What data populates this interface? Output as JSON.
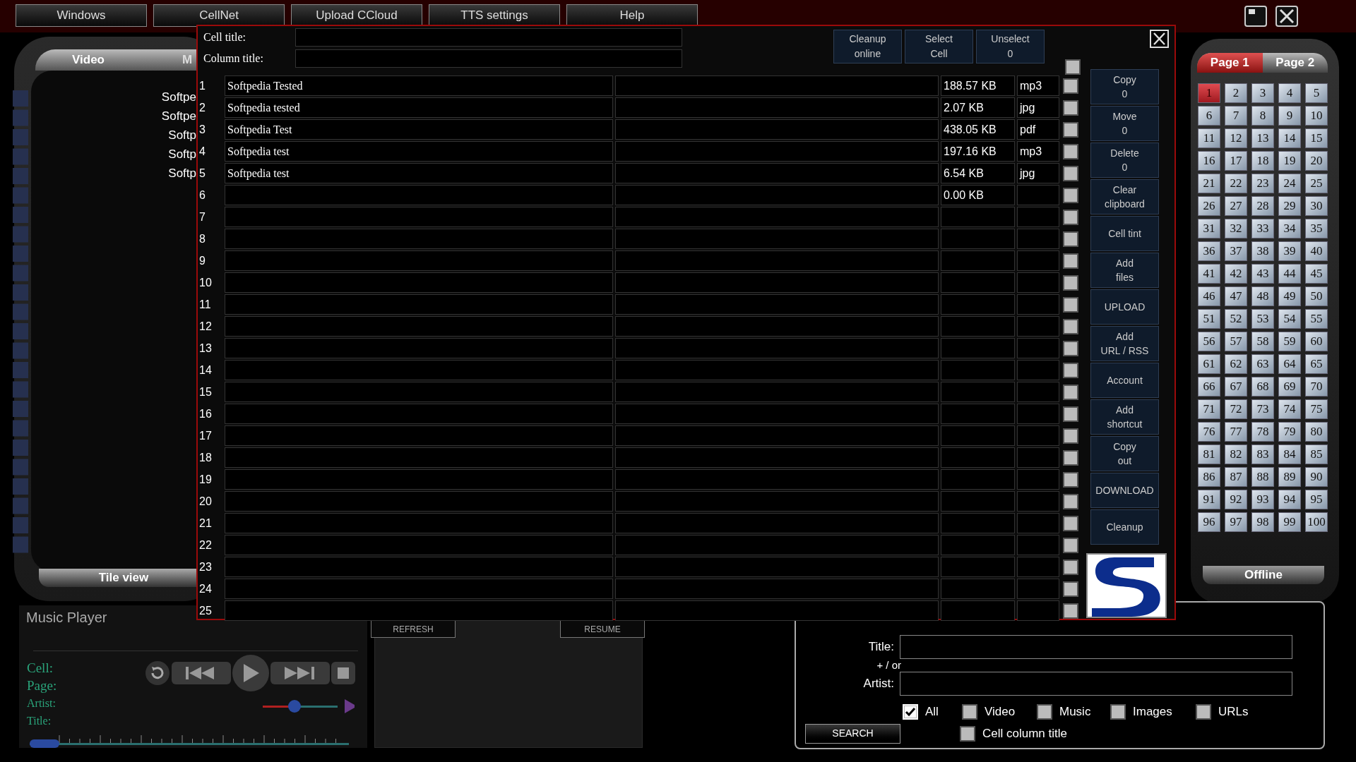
{
  "menu": [
    "Windows",
    "CellNet",
    "Upload CCloud",
    "TTS settings",
    "Help"
  ],
  "left_panel": {
    "tabs": [
      {
        "label": "Video",
        "selected": true
      },
      {
        "label": "M",
        "selected": false
      }
    ],
    "items": [
      "Softpe",
      "Softpe",
      "Softp",
      "Softp",
      "Softp"
    ],
    "footer": "Tile view"
  },
  "dialog": {
    "cell_title_label": "Cell title:",
    "column_title_label": "Column title:",
    "header_checked": false,
    "top_buttons": [
      {
        "lines": [
          "Cleanup",
          "online"
        ]
      },
      {
        "lines": [
          "Select",
          "Cell"
        ]
      },
      {
        "lines": [
          "Unselect",
          "0"
        ]
      }
    ],
    "rows": [
      {
        "number": "1",
        "title": "Softpedia Tested",
        "size": "188.57 KB",
        "type": "mp3",
        "checked": false
      },
      {
        "number": "2",
        "title": "Softpedia tested",
        "size": "2.07 KB",
        "type": "jpg",
        "checked": false
      },
      {
        "number": "3",
        "title": "Softpedia Test",
        "size": "438.05 KB",
        "type": "pdf",
        "checked": false
      },
      {
        "number": "4",
        "title": "Softpedia test",
        "size": "197.16 KB",
        "type": "mp3",
        "checked": false
      },
      {
        "number": "5",
        "title": "Softpedia test",
        "size": "6.54 KB",
        "type": "jpg",
        "checked": false
      },
      {
        "number": "6",
        "title": "",
        "size": "0.00 KB",
        "type": "",
        "checked": false
      },
      {
        "number": "7",
        "checked": false
      },
      {
        "number": "8",
        "checked": false
      },
      {
        "number": "9",
        "checked": false
      },
      {
        "number": "10",
        "checked": false
      },
      {
        "number": "11",
        "checked": false
      },
      {
        "number": "12",
        "checked": false
      },
      {
        "number": "13",
        "checked": false
      },
      {
        "number": "14",
        "checked": false
      },
      {
        "number": "15",
        "checked": false
      },
      {
        "number": "16",
        "checked": false
      },
      {
        "number": "17",
        "checked": false
      },
      {
        "number": "18",
        "checked": false
      },
      {
        "number": "19",
        "checked": false
      },
      {
        "number": "20",
        "checked": false
      },
      {
        "number": "21",
        "checked": false
      },
      {
        "number": "22",
        "checked": false
      },
      {
        "number": "23",
        "checked": false
      },
      {
        "number": "24",
        "checked": false
      },
      {
        "number": "25",
        "checked": false
      }
    ],
    "side_buttons": [
      {
        "lines": [
          "Copy",
          "0"
        ]
      },
      {
        "lines": [
          "Move",
          "0"
        ]
      },
      {
        "lines": [
          "Delete",
          "0"
        ]
      },
      {
        "lines": [
          "Clear",
          "clipboard"
        ]
      },
      {
        "lines": [
          "Cell tint"
        ]
      },
      {
        "lines": [
          "Add",
          "files"
        ]
      },
      {
        "lines": [
          "UPLOAD"
        ]
      },
      {
        "lines": [
          "Add",
          "URL / RSS"
        ]
      },
      {
        "lines": [
          "Account"
        ]
      },
      {
        "lines": [
          "Add",
          "shortcut"
        ]
      },
      {
        "lines": [
          "Copy",
          "out"
        ]
      },
      {
        "lines": [
          "DOWNLOAD"
        ]
      },
      {
        "lines": [
          "Cleanup"
        ]
      }
    ]
  },
  "right_panel": {
    "tabs": [
      {
        "label": "Page 1",
        "selected": true
      },
      {
        "label": "Page 2",
        "selected": false
      }
    ],
    "pages": [
      {
        "label": "1",
        "selected": true
      },
      {
        "label": "2",
        "selected": false
      },
      {
        "label": "3",
        "selected": false
      },
      {
        "label": "4",
        "selected": false
      },
      {
        "label": "5",
        "selected": false
      },
      {
        "label": "6",
        "selected": false
      },
      {
        "label": "7",
        "selected": false
      },
      {
        "label": "8",
        "selected": false
      },
      {
        "label": "9",
        "selected": false
      },
      {
        "label": "10",
        "selected": false
      },
      {
        "label": "11",
        "selected": false
      },
      {
        "label": "12",
        "selected": false
      },
      {
        "label": "13",
        "selected": false
      },
      {
        "label": "14",
        "selected": false
      },
      {
        "label": "15",
        "selected": false
      },
      {
        "label": "16",
        "selected": false
      },
      {
        "label": "17",
        "selected": false
      },
      {
        "label": "18",
        "selected": false
      },
      {
        "label": "19",
        "selected": false
      },
      {
        "label": "20",
        "selected": false
      },
      {
        "label": "21",
        "selected": false
      },
      {
        "label": "22",
        "selected": false
      },
      {
        "label": "23",
        "selected": false
      },
      {
        "label": "24",
        "selected": false
      },
      {
        "label": "25",
        "selected": false
      },
      {
        "label": "26",
        "selected": false
      },
      {
        "label": "27",
        "selected": false
      },
      {
        "label": "28",
        "selected": false
      },
      {
        "label": "29",
        "selected": false
      },
      {
        "label": "30",
        "selected": false
      },
      {
        "label": "31",
        "selected": false
      },
      {
        "label": "32",
        "selected": false
      },
      {
        "label": "33",
        "selected": false
      },
      {
        "label": "34",
        "selected": false
      },
      {
        "label": "35",
        "selected": false
      },
      {
        "label": "36",
        "selected": false
      },
      {
        "label": "37",
        "selected": false
      },
      {
        "label": "38",
        "selected": false
      },
      {
        "label": "39",
        "selected": false
      },
      {
        "label": "40",
        "selected": false
      },
      {
        "label": "41",
        "selected": false
      },
      {
        "label": "42",
        "selected": false
      },
      {
        "label": "43",
        "selected": false
      },
      {
        "label": "44",
        "selected": false
      },
      {
        "label": "45",
        "selected": false
      },
      {
        "label": "46",
        "selected": false
      },
      {
        "label": "47",
        "selected": false
      },
      {
        "label": "48",
        "selected": false
      },
      {
        "label": "49",
        "selected": false
      },
      {
        "label": "50",
        "selected": false
      },
      {
        "label": "51",
        "selected": false
      },
      {
        "label": "52",
        "selected": false
      },
      {
        "label": "53",
        "selected": false
      },
      {
        "label": "54",
        "selected": false
      },
      {
        "label": "55",
        "selected": false
      },
      {
        "label": "56",
        "selected": false
      },
      {
        "label": "57",
        "selected": false
      },
      {
        "label": "58",
        "selected": false
      },
      {
        "label": "59",
        "selected": false
      },
      {
        "label": "60",
        "selected": false
      },
      {
        "label": "61",
        "selected": false
      },
      {
        "label": "62",
        "selected": false
      },
      {
        "label": "63",
        "selected": false
      },
      {
        "label": "64",
        "selected": false
      },
      {
        "label": "65",
        "selected": false
      },
      {
        "label": "66",
        "selected": false
      },
      {
        "label": "67",
        "selected": false
      },
      {
        "label": "68",
        "selected": false
      },
      {
        "label": "69",
        "selected": false
      },
      {
        "label": "70",
        "selected": false
      },
      {
        "label": "71",
        "selected": false
      },
      {
        "label": "72",
        "selected": false
      },
      {
        "label": "73",
        "selected": false
      },
      {
        "label": "74",
        "selected": false
      },
      {
        "label": "75",
        "selected": false
      },
      {
        "label": "76",
        "selected": false
      },
      {
        "label": "77",
        "selected": false
      },
      {
        "label": "78",
        "selected": false
      },
      {
        "label": "79",
        "selected": false
      },
      {
        "label": "80",
        "selected": false
      },
      {
        "label": "81",
        "selected": false
      },
      {
        "label": "82",
        "selected": false
      },
      {
        "label": "83",
        "selected": false
      },
      {
        "label": "84",
        "selected": false
      },
      {
        "label": "85",
        "selected": false
      },
      {
        "label": "86",
        "selected": false
      },
      {
        "label": "87",
        "selected": false
      },
      {
        "label": "88",
        "selected": false
      },
      {
        "label": "89",
        "selected": false
      },
      {
        "label": "90",
        "selected": false
      },
      {
        "label": "91",
        "selected": false
      },
      {
        "label": "92",
        "selected": false
      },
      {
        "label": "93",
        "selected": false
      },
      {
        "label": "94",
        "selected": false
      },
      {
        "label": "95",
        "selected": false
      },
      {
        "label": "96",
        "selected": false
      },
      {
        "label": "97",
        "selected": false
      },
      {
        "label": "98",
        "selected": false
      },
      {
        "label": "99",
        "selected": false
      },
      {
        "label": "100",
        "selected": false
      }
    ],
    "footer": "Offline"
  },
  "music_player": {
    "title": "Music Player",
    "labels": [
      "Cell:",
      "Page:",
      "Artist:",
      "Title:"
    ],
    "volume": {
      "level": 0.42
    },
    "seek": {
      "level": 0.04
    }
  },
  "playlist": {
    "buttons": [
      "REFRESH",
      "RESUME"
    ]
  },
  "cell_search": {
    "fields": [
      {
        "label": "Title:"
      },
      {
        "label": "Artist:"
      }
    ],
    "connector": "+ / or",
    "filters": [
      {
        "label": "All",
        "checked": true
      },
      {
        "label": "Video",
        "checked": false
      },
      {
        "label": "Music",
        "checked": false
      },
      {
        "label": "Images",
        "checked": false
      },
      {
        "label": "URLs",
        "checked": false
      }
    ],
    "search_button": "SEARCH",
    "column_filter": {
      "label": "Cell column title",
      "checked": false
    }
  }
}
